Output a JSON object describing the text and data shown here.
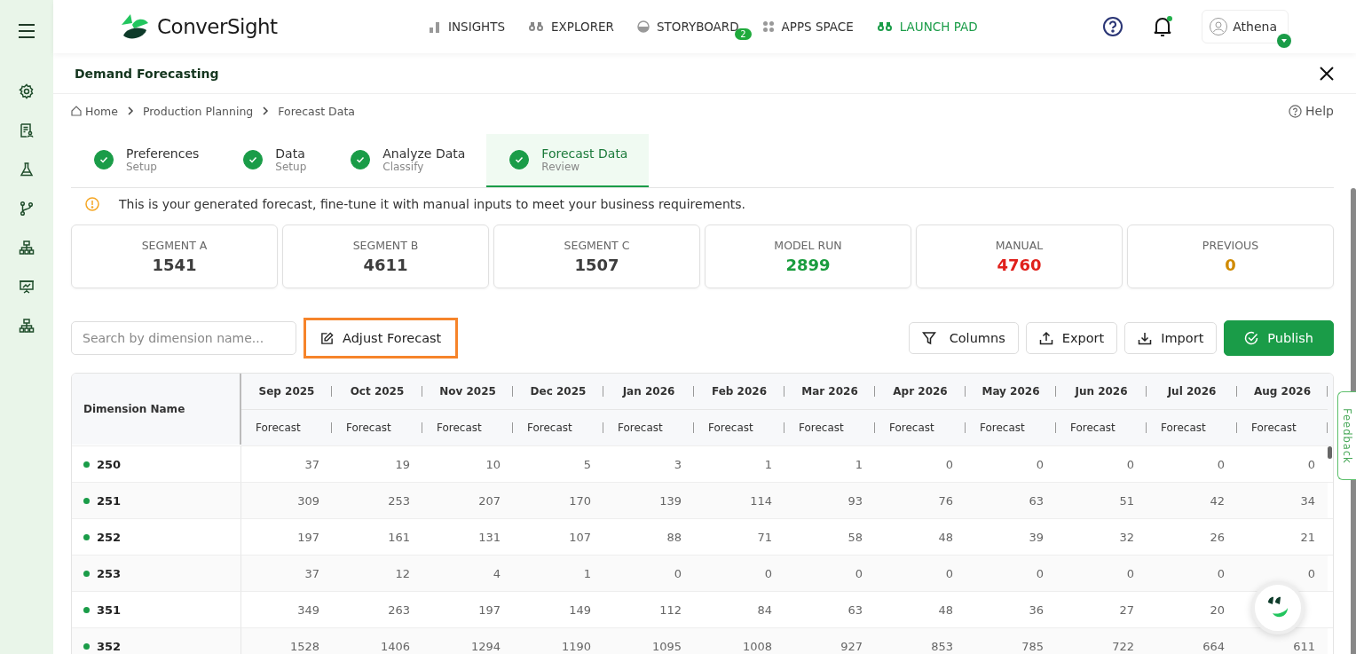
{
  "brand": "ConverSight",
  "nav": [
    {
      "label": "INSIGHTS",
      "kind": "bars",
      "selected": false
    },
    {
      "label": "EXPLORER",
      "kind": "binoculars",
      "selected": false
    },
    {
      "label": "STORYBOARD",
      "kind": "pie",
      "selected": false,
      "badge": "2"
    },
    {
      "label": "APPS SPACE",
      "kind": "dots",
      "selected": false
    },
    {
      "label": "LAUNCH PAD",
      "kind": "binoculars",
      "selected": true
    }
  ],
  "user": {
    "name": "Athena"
  },
  "sidebar": {
    "items": [
      {
        "kind": "settings"
      },
      {
        "kind": "report"
      },
      {
        "kind": "flask"
      },
      {
        "kind": "branch"
      },
      {
        "kind": "hierarchy"
      },
      {
        "kind": "presentation"
      },
      {
        "kind": "hierarchy"
      }
    ]
  },
  "page": {
    "title": "Demand Forecasting",
    "breadcrumbs": [
      "Home",
      "Production Planning",
      "Forecast Data"
    ],
    "help": "Help"
  },
  "steps": [
    {
      "title": "Preferences",
      "subtitle": "Setup",
      "done": true,
      "selected": false
    },
    {
      "title": "Data",
      "subtitle": "Setup",
      "done": true,
      "selected": false
    },
    {
      "title": "Analyze Data",
      "subtitle": "Classify",
      "done": true,
      "selected": false
    },
    {
      "title": "Forecast Data",
      "subtitle": "Review",
      "done": true,
      "selected": true
    }
  ],
  "notice": "This is your generated forecast, fine-tune it with manual inputs to meet your business requirements.",
  "segments": [
    {
      "label": "SEGMENT A",
      "value": "1541",
      "color": "#3d3d3d"
    },
    {
      "label": "SEGMENT B",
      "value": "4611",
      "color": "#3d3d3d"
    },
    {
      "label": "SEGMENT C",
      "value": "1507",
      "color": "#3d3d3d"
    },
    {
      "label": "MODEL RUN",
      "value": "2899",
      "color": "#1a9c3e"
    },
    {
      "label": "MANUAL",
      "value": "4760",
      "color": "#e0201b"
    },
    {
      "label": "PREVIOUS",
      "value": "0",
      "color": "#d08a00"
    }
  ],
  "toolbar": {
    "search": {
      "placeholder": "Search by dimension name..."
    },
    "adjust": "Adjust Forecast",
    "columns": "Columns",
    "export": "Export",
    "import": "Import",
    "publish": "Publish"
  },
  "table": {
    "first_column": "Dimension Name",
    "months": [
      "Sep 2025",
      "Oct 2025",
      "Nov 2025",
      "Dec 2025",
      "Jan 2026",
      "Feb 2026",
      "Mar 2026",
      "Apr 2026",
      "May 2026",
      "Jun 2026",
      "Jul 2026",
      "Aug 2026"
    ],
    "sub_headers": [
      "Forecast",
      "Forecast",
      "Forecast",
      "Forecast",
      "Forecast",
      "Forecast",
      "Forecast",
      "Forecast",
      "Forecast",
      "Forecast",
      "Forecast",
      "Forecast"
    ],
    "rows": [
      {
        "name": "250",
        "values": [
          "37",
          "19",
          "10",
          "5",
          "3",
          "1",
          "1",
          "0",
          "0",
          "0",
          "0",
          "0"
        ]
      },
      {
        "name": "251",
        "values": [
          "309",
          "253",
          "207",
          "170",
          "139",
          "114",
          "93",
          "76",
          "63",
          "51",
          "42",
          "34"
        ]
      },
      {
        "name": "252",
        "values": [
          "197",
          "161",
          "131",
          "107",
          "88",
          "71",
          "58",
          "48",
          "39",
          "32",
          "26",
          "21"
        ]
      },
      {
        "name": "253",
        "values": [
          "37",
          "12",
          "4",
          "1",
          "0",
          "0",
          "0",
          "0",
          "0",
          "0",
          "0",
          "0"
        ]
      },
      {
        "name": "351",
        "values": [
          "349",
          "263",
          "197",
          "149",
          "112",
          "84",
          "63",
          "48",
          "36",
          "27",
          "20"
        ]
      },
      {
        "name": "352",
        "values": [
          "1528",
          "1406",
          "1294",
          "1190",
          "1095",
          "1008",
          "927",
          "853",
          "785",
          "722",
          "664",
          "611"
        ]
      }
    ]
  },
  "feedback": "Feedback"
}
